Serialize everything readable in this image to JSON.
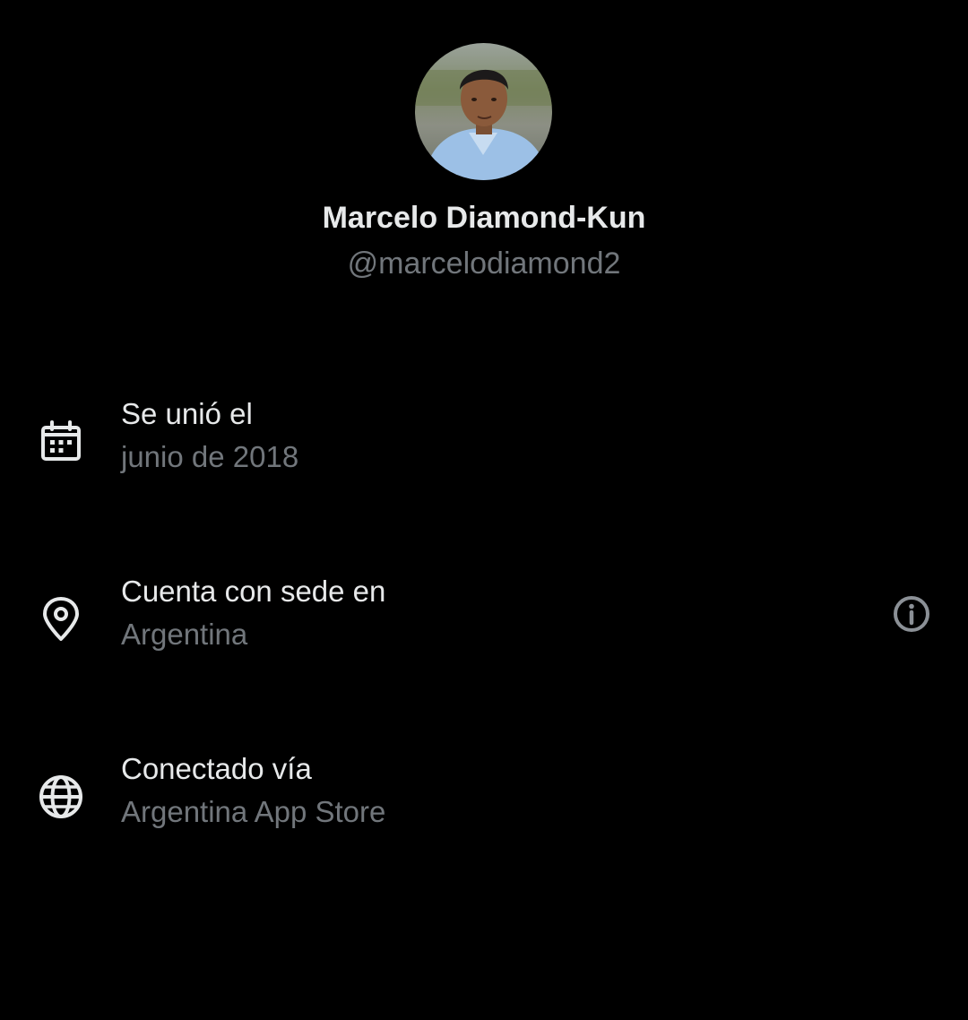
{
  "profile": {
    "display_name": "Marcelo Diamond-Kun",
    "handle": "@marcelodiamond2"
  },
  "details": [
    {
      "icon": "calendar-icon",
      "label": "Se unió el",
      "value": "junio de 2018"
    },
    {
      "icon": "location-pin-icon",
      "label": "Cuenta con sede en",
      "value": "Argentina"
    },
    {
      "icon": "globe-icon",
      "label": "Conectado vía",
      "value": "Argentina App Store"
    }
  ],
  "theme": {
    "background": "#000000",
    "primary_text": "#e7e9ea",
    "secondary_text": "#71767b"
  }
}
